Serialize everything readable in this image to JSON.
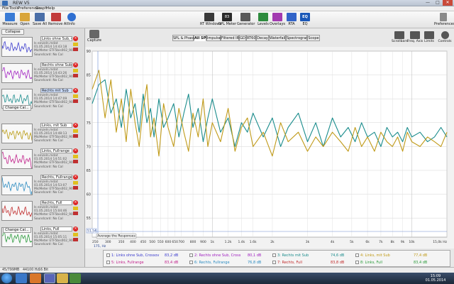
{
  "window": {
    "title": "REW V5",
    "min": "—",
    "max": "□",
    "close": "✕"
  },
  "menu": [
    "File",
    "Tools",
    "Preferences",
    "Graph",
    "Help"
  ],
  "toolbar": {
    "left": [
      {
        "label": "Measure",
        "icon": "microphone-icon",
        "color": "#3a7bd5"
      },
      {
        "label": "Open",
        "icon": "folder-icon",
        "color": "#d9a53a"
      },
      {
        "label": "Save All",
        "icon": "save-icon",
        "color": "#4b6fa8"
      },
      {
        "label": "Remove All",
        "icon": "remove-icon",
        "color": "#c23b3b"
      },
      {
        "label": "Info",
        "icon": "info-icon",
        "color": "#2f6fd1"
      }
    ],
    "center": [
      {
        "label": "RT Windows",
        "icon": "rt-windows-icon",
        "color": "#3a3a3a"
      },
      {
        "label": "SPL Meter",
        "icon": "spl-meter-icon",
        "color": "#2a2a2a",
        "badge": "83"
      },
      {
        "label": "Generator",
        "icon": "generator-icon",
        "color": "#5a5a5a"
      },
      {
        "label": "Levels",
        "icon": "levels-icon",
        "color": "#2e8b3e"
      },
      {
        "label": "Overlays",
        "icon": "overlays-icon",
        "color": "#a23ab0"
      },
      {
        "label": "RTA",
        "icon": "rta-icon",
        "color": "#3264c8"
      },
      {
        "label": "EQ",
        "icon": "eq-icon",
        "color": "#1a58b8",
        "badge": "EQ"
      }
    ],
    "preferences": {
      "label": "Preferences",
      "icon": "preferences-icon"
    }
  },
  "left_panel": {
    "collapse_label": "Collapse",
    "change_cal_label": "Change Cal...",
    "measurements": [
      {
        "name": "Links ohne Sub, Crosso",
        "file": "Is einzeln.mdat",
        "date": "01.05.2014 14:43:18",
        "mic": "MicMeter ETF5bis002_90",
        "sc": "Soundcard: No Cal",
        "color": "#3a3acd",
        "selected": false
      },
      {
        "name": "Rechts ohne Sub, Cross",
        "file": "Is einzeln.mdat",
        "date": "01.05.2014 14:43:26",
        "mic": "MicMeter ETF5bis002_90",
        "sc": "Soundcard: No Cal",
        "color": "#a020c0",
        "selected": false
      },
      {
        "name": "Rechts mit Sub",
        "file": "Is einzeln.mdat",
        "date": "01.05.2014 14:47:09",
        "mic": "MicMeter ETF5bis002_90",
        "sc": "Soundcard: No Cal",
        "color": "#1a8c8c",
        "selected": true
      },
      {
        "name": "Links, mit Sub",
        "file": "Is einzeln.mdat",
        "date": "01.05.2014 14:48:13",
        "mic": "MicMeter ETF5bis002_90",
        "sc": "Soundcard: No Cal",
        "color": "#b89a10",
        "selected": false
      },
      {
        "name": "Links, Fullrange",
        "file": "Is einzeln.mdat",
        "date": "01.05.2014 14:51:02",
        "mic": "MicMeter ETF5bis002_90",
        "sc": "Soundcard: No Cal",
        "color": "#c0208a",
        "selected": false
      },
      {
        "name": "Rechts, Fullrange",
        "file": "Is einzeln.mdat",
        "date": "01.05.2014 14:53:07",
        "mic": "MicMeter ETF5bis002_90",
        "sc": "Soundcard: No Cal",
        "color": "#2a8ac0",
        "selected": false
      },
      {
        "name": "Rechts, Full",
        "file": "Is einzeln.mdat",
        "date": "01.05.2014 15:04:46",
        "mic": "MicMeter ETF5bis002_90",
        "sc": "Soundcard: No Cal",
        "color": "#c02a2a",
        "selected": false
      },
      {
        "name": "Links, Full",
        "file": "Is einzeln.mdat",
        "date": "01.05.2014 15:05:11",
        "mic": "MicMeter ETF5bis002_90",
        "sc": "Soundcard: No Cal",
        "color": "#2a9a3a",
        "selected": false
      }
    ]
  },
  "capture": {
    "label": "Capture",
    "icon": "camera-icon"
  },
  "tabs": [
    "SPL & Phase",
    "All SPL",
    "Impulse",
    "Filtered IR",
    "GD",
    "RT60",
    "Decay",
    "Waterfall",
    "Spectrogram",
    "Scope"
  ],
  "active_tab": "All SPL",
  "right_tools": [
    {
      "label": "Scrollbars",
      "icon": "scrollbars-icon"
    },
    {
      "label": "Freq. Axis",
      "icon": "freq-axis-icon"
    },
    {
      "label": "Limits",
      "icon": "limits-icon"
    },
    {
      "label": "Controls",
      "icon": "controls-icon"
    }
  ],
  "plot": {
    "average_button": "Average the Responses",
    "y_readout": "51,54",
    "x_readout": "175, Hz",
    "x_ticks": [
      "250",
      "300",
      "350",
      "400",
      "450",
      "500",
      "550",
      "600",
      "650",
      "700",
      "800",
      "900",
      "1k",
      "1.2k",
      "1.4k",
      "1.6k",
      "2k",
      "3k",
      "4k",
      "5k",
      "6k",
      "7k",
      "8k",
      "9k",
      "10k",
      "15,0k Hz"
    ]
  },
  "chart_data": {
    "type": "line",
    "xlabel": "",
    "ylabel": "",
    "xscale": "log",
    "xlim": [
      250,
      15000
    ],
    "ylim": [
      51,
      90
    ],
    "grid": true,
    "y_ticks": [
      55,
      60,
      65,
      70,
      75,
      80,
      85,
      90
    ],
    "series": [
      {
        "name": "3: Rechts mit Sub",
        "color": "#1a8c8c",
        "x": [
          250,
          270,
          290,
          310,
          330,
          350,
          370,
          390,
          410,
          430,
          450,
          470,
          490,
          510,
          540,
          570,
          600,
          640,
          680,
          720,
          760,
          800,
          850,
          900,
          950,
          1000,
          1100,
          1200,
          1300,
          1400,
          1500,
          1600,
          1800,
          2000,
          2200,
          2400,
          2700,
          3000,
          3300,
          3600,
          4000,
          4400,
          4800,
          5200,
          5600,
          6000,
          6500,
          7000,
          7500,
          8000,
          8500,
          9000,
          9500,
          10000,
          11000,
          12000,
          13000,
          14000,
          15000
        ],
        "values": [
          79,
          83,
          84,
          77,
          80,
          74,
          82,
          76,
          79,
          73,
          81,
          75,
          78,
          72,
          80,
          74,
          76,
          79,
          72,
          77,
          81,
          74,
          78,
          71,
          76,
          80,
          73,
          76,
          70,
          75,
          73,
          77,
          72,
          76,
          70,
          74,
          77,
          71,
          75,
          70,
          76,
          72,
          74,
          71,
          75,
          72,
          73,
          70,
          74,
          72,
          73,
          71,
          74,
          72,
          73,
          71,
          72,
          74,
          72
        ]
      },
      {
        "name": "4: Links, mit Sub",
        "color": "#c09a18",
        "x": [
          250,
          270,
          290,
          310,
          330,
          350,
          370,
          390,
          410,
          430,
          450,
          470,
          490,
          510,
          540,
          570,
          600,
          640,
          680,
          720,
          760,
          800,
          850,
          900,
          950,
          1000,
          1100,
          1200,
          1300,
          1400,
          1500,
          1600,
          1800,
          2000,
          2200,
          2400,
          2700,
          3000,
          3300,
          3600,
          4000,
          4400,
          4800,
          5200,
          5600,
          6000,
          6500,
          7000,
          7500,
          8000,
          8500,
          9000,
          9500,
          10000,
          11000,
          12000,
          13000,
          14000,
          15000
        ],
        "values": [
          82,
          86,
          76,
          84,
          73,
          80,
          71,
          82,
          75,
          70,
          78,
          83,
          72,
          76,
          68,
          79,
          74,
          70,
          78,
          73,
          69,
          77,
          72,
          80,
          70,
          75,
          71,
          78,
          69,
          74,
          76,
          70,
          73,
          68,
          75,
          71,
          73,
          69,
          72,
          70,
          73,
          71,
          69,
          74,
          70,
          72,
          69,
          73,
          71,
          70,
          72,
          69,
          73,
          71,
          70,
          72,
          71,
          70,
          73
        ]
      }
    ]
  },
  "legend": [
    {
      "label": "1: Links ohne Sub, Crossov",
      "value": "83,2",
      "color": "#3a3acd"
    },
    {
      "label": "2: Rechts ohne Sub, Cross",
      "value": "80,1",
      "color": "#a020c0"
    },
    {
      "label": "3: Rechts mit Sub",
      "value": "74,6",
      "color": "#1a8c8c"
    },
    {
      "label": "4: Links, mit Sub",
      "value": "77,4",
      "color": "#c09a18"
    },
    {
      "label": "5: Links, Fullrange",
      "value": "83,4",
      "color": "#c0208a"
    },
    {
      "label": "6: Rechts, Fullrange",
      "value": "76,8",
      "color": "#2a8ac0"
    },
    {
      "label": "7: Rechts, Full",
      "value": "83,8",
      "color": "#c02a2a"
    },
    {
      "label": "8: Links, Full",
      "value": "83,4",
      "color": "#2a9a3a"
    }
  ],
  "legend_unit": "dB",
  "status": {
    "mem": "45/799MB",
    "rate": "44100 Hz",
    "bits": "16 Bit"
  },
  "taskbar": {
    "time": "15:09",
    "date": "01.05.2014"
  }
}
